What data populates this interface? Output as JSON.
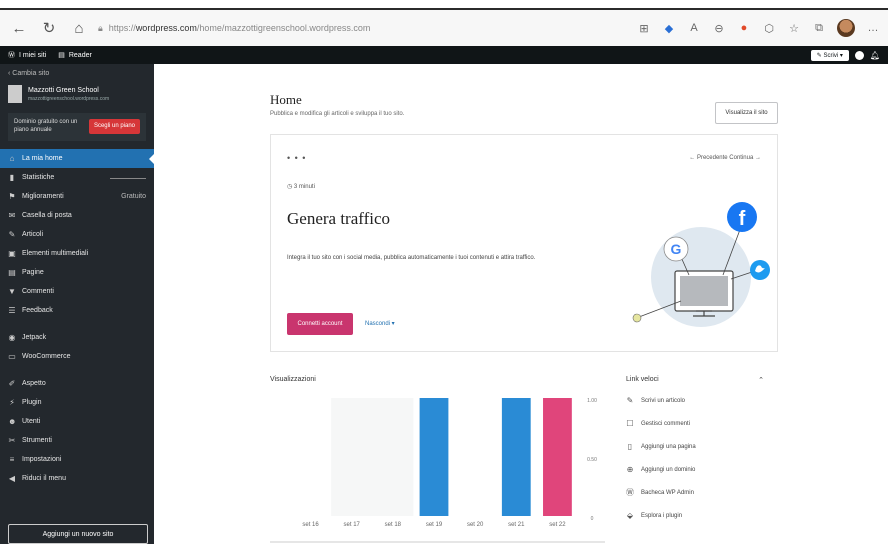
{
  "browser": {
    "url_prefix": "https://",
    "url_domain": "wordpress.com",
    "url_path": "/home/mazzottigreenschool.wordpress.com"
  },
  "adminbar": {
    "my_sites": "I miei siti",
    "reader": "Reader",
    "write": "Scrivi"
  },
  "sidebar": {
    "back": "Cambia sito",
    "site_name": "Mazzotti Green School",
    "site_url": "mazzottigreenschool.wordpress.com",
    "upgrade_text": "Dominio gratuito con un piano annuale",
    "upgrade_button": "Scegli un piano",
    "items": [
      {
        "label": "La mia home",
        "icon": "home-icon",
        "glyph": "⌂"
      },
      {
        "label": "Statistiche",
        "icon": "stats-icon",
        "glyph": "▮"
      },
      {
        "label": "Miglioramenti",
        "icon": "upgrades-icon",
        "glyph": "⚑",
        "extra": "Gratuito"
      },
      {
        "label": "Casella di posta",
        "icon": "inbox-icon",
        "glyph": "✉"
      },
      {
        "label": "Articoli",
        "icon": "posts-icon",
        "glyph": "✎"
      },
      {
        "label": "Elementi multimediali",
        "icon": "media-icon",
        "glyph": "▣"
      },
      {
        "label": "Pagine",
        "icon": "pages-icon",
        "glyph": "▤"
      },
      {
        "label": "Commenti",
        "icon": "comments-icon",
        "glyph": "▼"
      },
      {
        "label": "Feedback",
        "icon": "feedback-icon",
        "glyph": "☰"
      },
      {
        "label": "Jetpack",
        "icon": "jetpack-icon",
        "glyph": "◉"
      },
      {
        "label": "WooCommerce",
        "icon": "woocommerce-icon",
        "glyph": "▭"
      },
      {
        "label": "Aspetto",
        "icon": "appearance-icon",
        "glyph": "✐"
      },
      {
        "label": "Plugin",
        "icon": "plugins-icon",
        "glyph": "⚡"
      },
      {
        "label": "Utenti",
        "icon": "users-icon",
        "glyph": "☻"
      },
      {
        "label": "Strumenti",
        "icon": "tools-icon",
        "glyph": "✂"
      },
      {
        "label": "Impostazioni",
        "icon": "settings-icon",
        "glyph": "≡"
      },
      {
        "label": "Riduci il menu",
        "icon": "collapse-icon",
        "glyph": "◀"
      }
    ],
    "add_site": "Aggiungi un nuovo sito"
  },
  "main": {
    "title": "Home",
    "subtitle": "Pubblica e modifica gli articoli e sviluppa il tuo sito.",
    "visit_site": "Visualizza il sito",
    "card": {
      "dots": "• • •",
      "pager": "← Precedente   Continua →",
      "time": "3 minuti",
      "heading": "Genera traffico",
      "description": "Integra il tuo sito con i social media, pubblica automaticamente i tuoi contenuti e attira traffico.",
      "primary_button": "Connetti account",
      "secondary": "Nascondi ▾"
    },
    "views": {
      "title": "Visualizzazioni"
    },
    "quick_links": {
      "title": "Link veloci",
      "items": [
        {
          "label": "Scrivi un articolo",
          "icon": "pencil-icon",
          "glyph": "✎"
        },
        {
          "label": "Gestisci commenti",
          "icon": "comment-icon",
          "glyph": "☐"
        },
        {
          "label": "Aggiungi una pagina",
          "icon": "page-icon",
          "glyph": "▯"
        },
        {
          "label": "Aggiungi un dominio",
          "icon": "globe-icon",
          "glyph": "⊕"
        },
        {
          "label": "Bacheca WP Admin",
          "icon": "wordpress-icon",
          "glyph": "Ⓦ"
        },
        {
          "label": "Esplora i plugin",
          "icon": "plug-icon",
          "glyph": "⬙"
        }
      ]
    }
  },
  "chart_data": {
    "type": "bar",
    "categories": [
      "set 16",
      "set 17",
      "set 18",
      "set 19",
      "set 20",
      "set 21",
      "set 22"
    ],
    "values": [
      0,
      0,
      0,
      1,
      0,
      1,
      1
    ],
    "highlight_index": 6,
    "ylim": [
      0,
      1
    ],
    "yticks": [
      "1.00",
      "0.50",
      "0"
    ],
    "colors": {
      "bar": "#2a8bd5",
      "highlight": "#e0457b"
    }
  }
}
